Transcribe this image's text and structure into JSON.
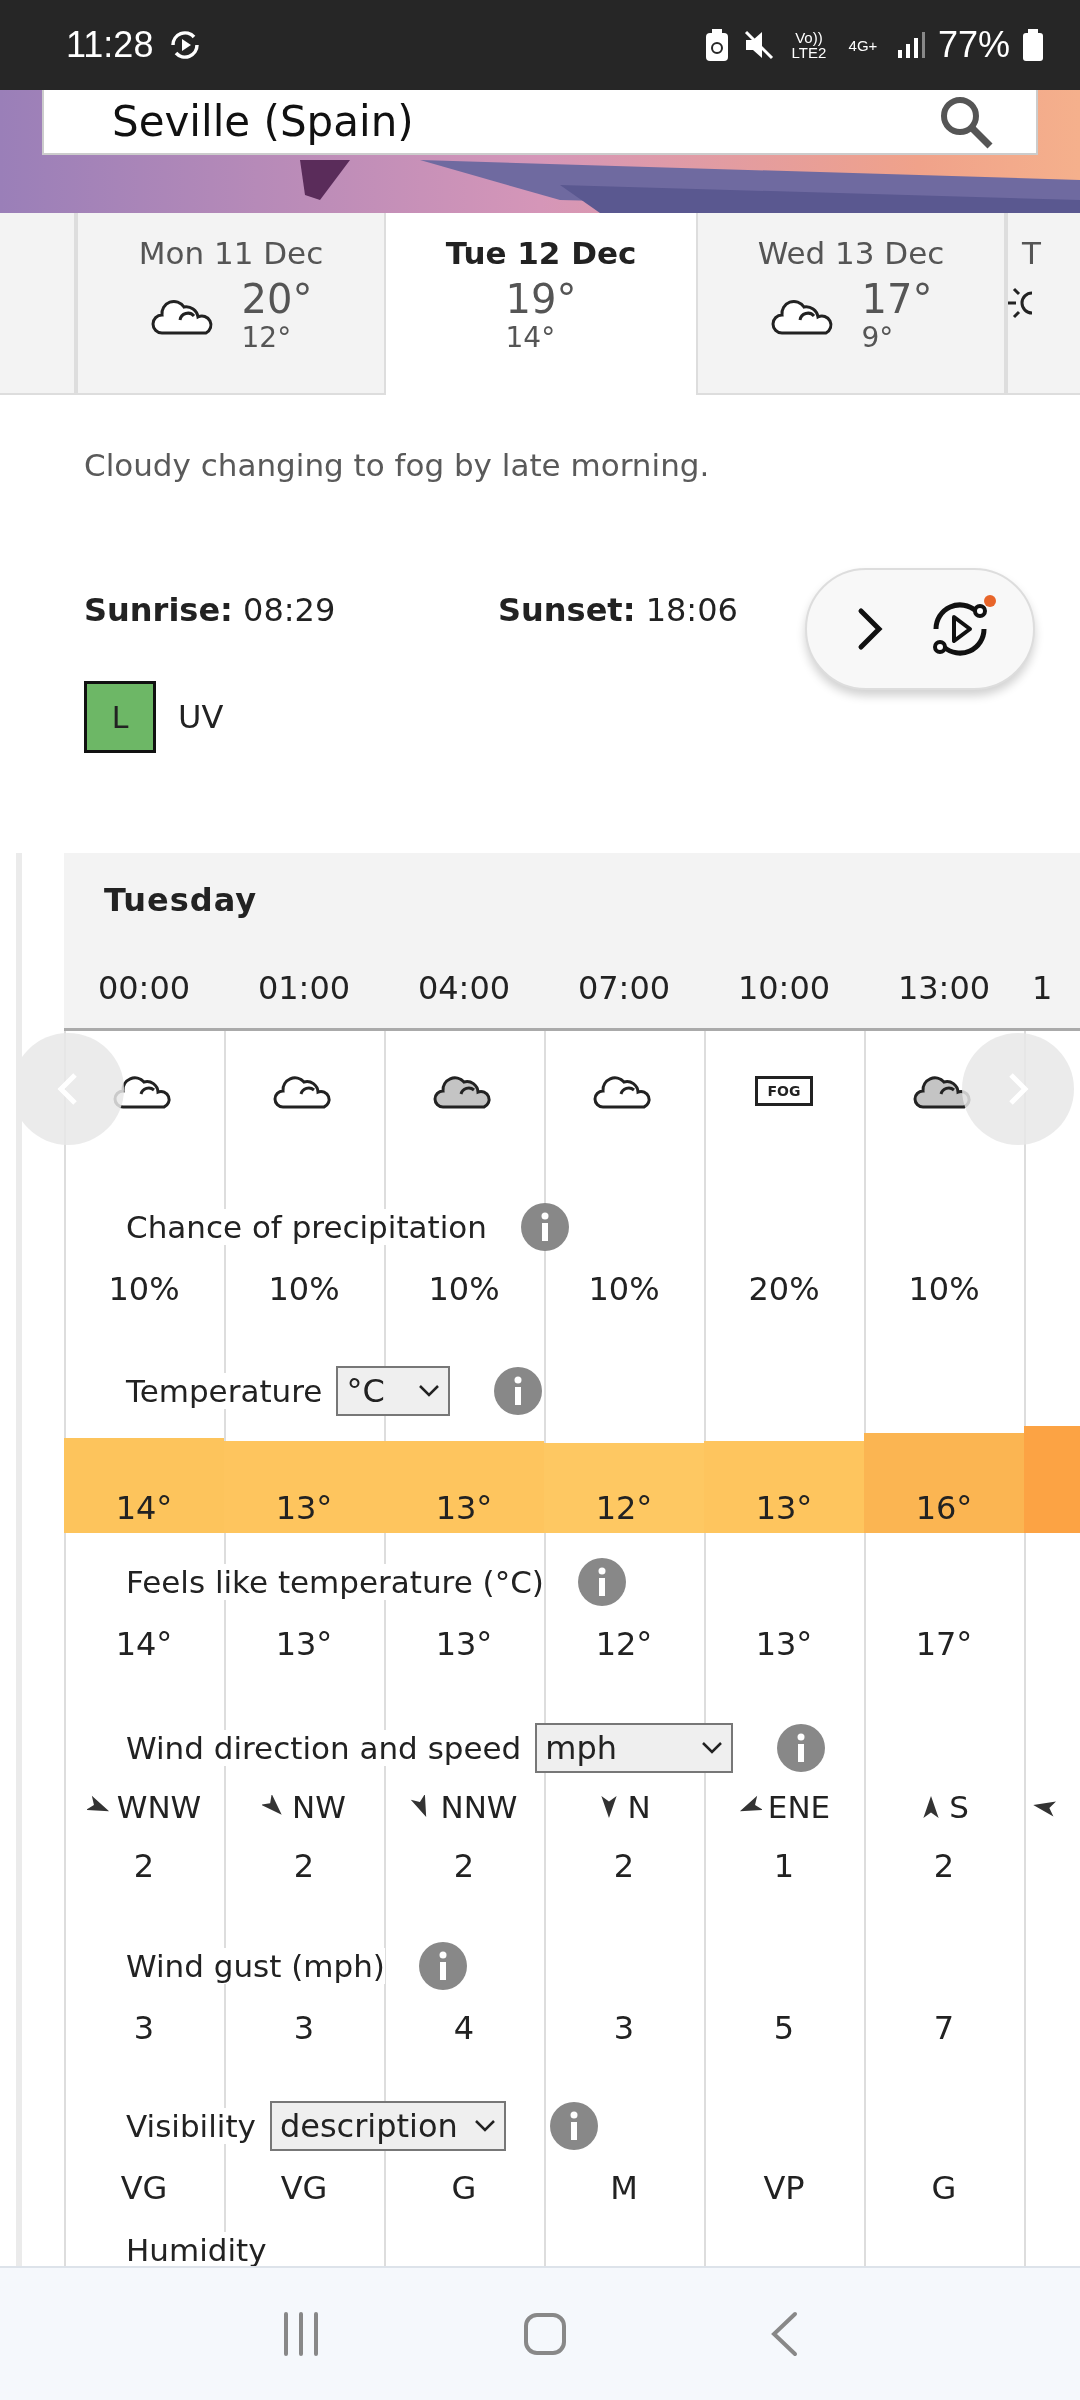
{
  "status_bar": {
    "time": "11:28",
    "signal_text": "Vo)) LTE2",
    "network": "4G+",
    "battery": "77%"
  },
  "search": {
    "value": "Seville (Spain)"
  },
  "day_tabs": [
    {
      "kind": "blank",
      "selected": false
    },
    {
      "kind": "day",
      "label": "Mon 11 Dec",
      "high": "20°",
      "low": "12°",
      "selected": false
    },
    {
      "kind": "day",
      "label": "Tue 12 Dec",
      "high": "19°",
      "low": "14°",
      "selected": true
    },
    {
      "kind": "day",
      "label": "Wed 13 Dec",
      "high": "17°",
      "low": "9°",
      "selected": false
    },
    {
      "kind": "cut",
      "label": "T",
      "selected": false
    }
  ],
  "summary": "Cloudy changing to fog by late morning.",
  "sunrise": {
    "label": "Sunrise:",
    "value": "08:29"
  },
  "sunset": {
    "label": "Sunset:",
    "value": "18:06"
  },
  "uv": {
    "level_text": "L",
    "label": "UV",
    "color": "#6db766"
  },
  "forecast": {
    "day": "Tuesday",
    "precip_label": "Chance of precipitation",
    "temp_label": "Temperature",
    "temp_unit": "°C",
    "feels_label": "Feels like temperature (°C)",
    "wind_label": "Wind direction and speed",
    "wind_unit": "mph",
    "gust_label": "Wind gust (mph)",
    "vis_label": "Visibility",
    "vis_mode": "description",
    "humidity_label": "Humidity",
    "hours": [
      {
        "time": "00:00",
        "kind": "cloud",
        "precip": "10%",
        "temp": "14°",
        "color": "#fdc45c",
        "feels": "14°",
        "dir": "WNW",
        "speed": "2",
        "gust": "3",
        "vis": "VG"
      },
      {
        "time": "01:00",
        "kind": "cloud",
        "precip": "10%",
        "temp": "13°",
        "color": "#fec55e",
        "feels": "13°",
        "dir": "NW",
        "speed": "2",
        "gust": "3",
        "vis": "VG"
      },
      {
        "time": "04:00",
        "kind": "grey-cloud",
        "precip": "10%",
        "temp": "13°",
        "color": "#fec55e",
        "feels": "13°",
        "dir": "NNW",
        "speed": "2",
        "gust": "4",
        "vis": "G"
      },
      {
        "time": "07:00",
        "kind": "cloud",
        "precip": "10%",
        "temp": "12°",
        "color": "#fec862",
        "feels": "12°",
        "dir": "N",
        "speed": "2",
        "gust": "3",
        "vis": "M"
      },
      {
        "time": "10:00",
        "kind": "fog",
        "icon_text": "FOG",
        "precip": "20%",
        "temp": "13°",
        "color": "#fec55e",
        "feels": "13°",
        "dir": "ENE",
        "speed": "1",
        "gust": "5",
        "vis": "VP"
      },
      {
        "time": "13:00",
        "kind": "grey-cloud",
        "precip": "10%",
        "temp": "16°",
        "color": "#fbb552",
        "feels": "17°",
        "dir": "S",
        "speed": "2",
        "gust": "7",
        "vis": "G"
      }
    ],
    "next_column": {
      "time": "1",
      "color": "#fca344"
    }
  }
}
